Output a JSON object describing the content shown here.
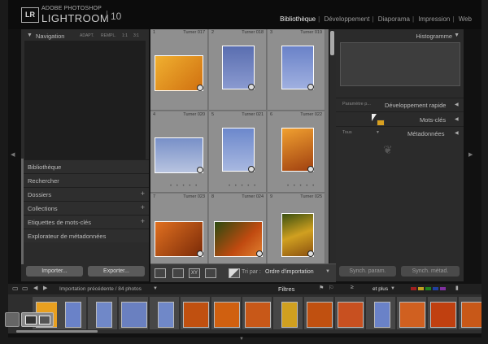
{
  "app": {
    "logo_badge": "LR",
    "logo_small": "ADOBE PHOTOSHOP",
    "logo_big": "LIGHTROOM",
    "version": "10"
  },
  "modules": [
    "Bibliothèque",
    "Développement",
    "Diaporama",
    "Impression",
    "Web"
  ],
  "left_panel": {
    "navigator_title": "Navigation",
    "navigator_modes": [
      "ADAPT.",
      "REMPL.",
      "1:1",
      "3:1"
    ],
    "sections": [
      {
        "label": "Bibliothèque",
        "plus": ""
      },
      {
        "label": "Rechercher",
        "plus": ""
      },
      {
        "label": "Dossiers",
        "plus": "+"
      },
      {
        "label": "Collections",
        "plus": "+"
      },
      {
        "label": "Etiquettes de mots-clés",
        "plus": "+"
      },
      {
        "label": "Explorateur de métadonnées",
        "plus": ""
      }
    ],
    "import_label": "Importer...",
    "export_label": "Exporter..."
  },
  "grid": {
    "cells": [
      {
        "num": "1",
        "name": "Turner 017",
        "color": "#e8a020"
      },
      {
        "num": "2",
        "name": "Turner 018",
        "color": "#5a70b8"
      },
      {
        "num": "3",
        "name": "Turner 019",
        "color": "#6a82c8"
      },
      {
        "num": "4",
        "name": "Turner 020",
        "color": "#7890c8"
      },
      {
        "num": "5",
        "name": "Turner 021",
        "color": "#6c88cc"
      },
      {
        "num": "6",
        "name": "Turner 022",
        "color": "#d87010"
      },
      {
        "num": "7",
        "name": "Turner 023",
        "color": "#c04a10"
      },
      {
        "num": "8",
        "name": "Turner 024",
        "color": "#8a3010"
      },
      {
        "num": "9",
        "name": "Turner 025",
        "color": "#b89010"
      }
    ]
  },
  "toolbar": {
    "sort_label": "Tri par :",
    "sort_value": "Ordre d'importation"
  },
  "right_panel": {
    "histogram_title": "Histogramme",
    "preset_label": "Paramètre p...",
    "quick_dev": "Développement rapide",
    "keywords": "Mots-clés",
    "metadata_preset": "Tous",
    "metadata": "Métadonnées",
    "sync_params": "Synch. param.",
    "sync_meta": "Synch. métad."
  },
  "filmstrip": {
    "source": "Importation précédente / 84 photos",
    "filters_label": "Filtres",
    "and_more": "et plus",
    "label_colors": [
      "#a02020",
      "#c0a020",
      "#208020",
      "#2040a0",
      "#8030a0"
    ],
    "thumbs": [
      "#e8a020",
      "#6a82c8",
      "#7088c8",
      "#6a80c0",
      "#7088c8",
      "#c05010",
      "#d06010",
      "#c85818",
      "#d0a020",
      "#c05010",
      "#c85020",
      "#6a82c8",
      "#d06020",
      "#c04010"
    ]
  }
}
